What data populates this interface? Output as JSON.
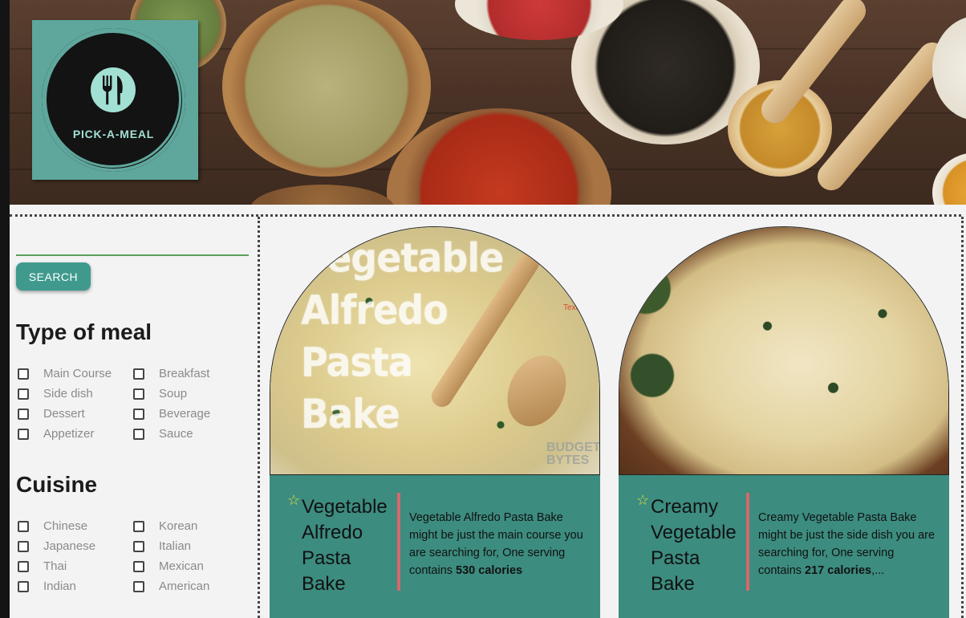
{
  "brand": {
    "logo_text": "PICK-A-MEAL",
    "colors": {
      "teal": "#5fa79c",
      "logo_mint": "#a3e0d4",
      "button": "#3f9a8d",
      "card_panel": "#3c8c7f",
      "accent_bar": "#d9676a",
      "star": "#e6df3e"
    }
  },
  "search": {
    "button_label": "SEARCH"
  },
  "filters": {
    "type_title": "Type of meal",
    "type_options": [
      "Main Course",
      "Breakfast",
      "Side dish",
      "Soup",
      "Dessert",
      "Beverage",
      "Appetizer",
      "Sauce"
    ],
    "cuisine_title": "Cuisine",
    "cuisine_options": [
      "Chinese",
      "Korean",
      "Japanese",
      "Italian",
      "Thai",
      "Mexican",
      "Indian",
      "American"
    ]
  },
  "recipes": [
    {
      "name": "Vegetable Alfredo Pasta Bake",
      "photo_text": [
        "Vegetable",
        "Alfredo",
        "Pasta",
        "Bake"
      ],
      "photo_small_text": "Text",
      "photo_watermark": "BUDGET BYTES",
      "desc_text": "Vegetable Alfredo Pasta Bake might be just the main course you are searching for, One serving contains ",
      "desc_bold": "530 calories",
      "desc_tail": "",
      "icon": "star-outline-icon"
    },
    {
      "name": "Creamy Vegetable Pasta Bake",
      "desc_text": "Creamy Vegetable Pasta Bake might be just the side dish you are searching for, One serving contains ",
      "desc_bold": "217 calories",
      "desc_tail": ",...",
      "icon": "star-outline-icon"
    }
  ]
}
